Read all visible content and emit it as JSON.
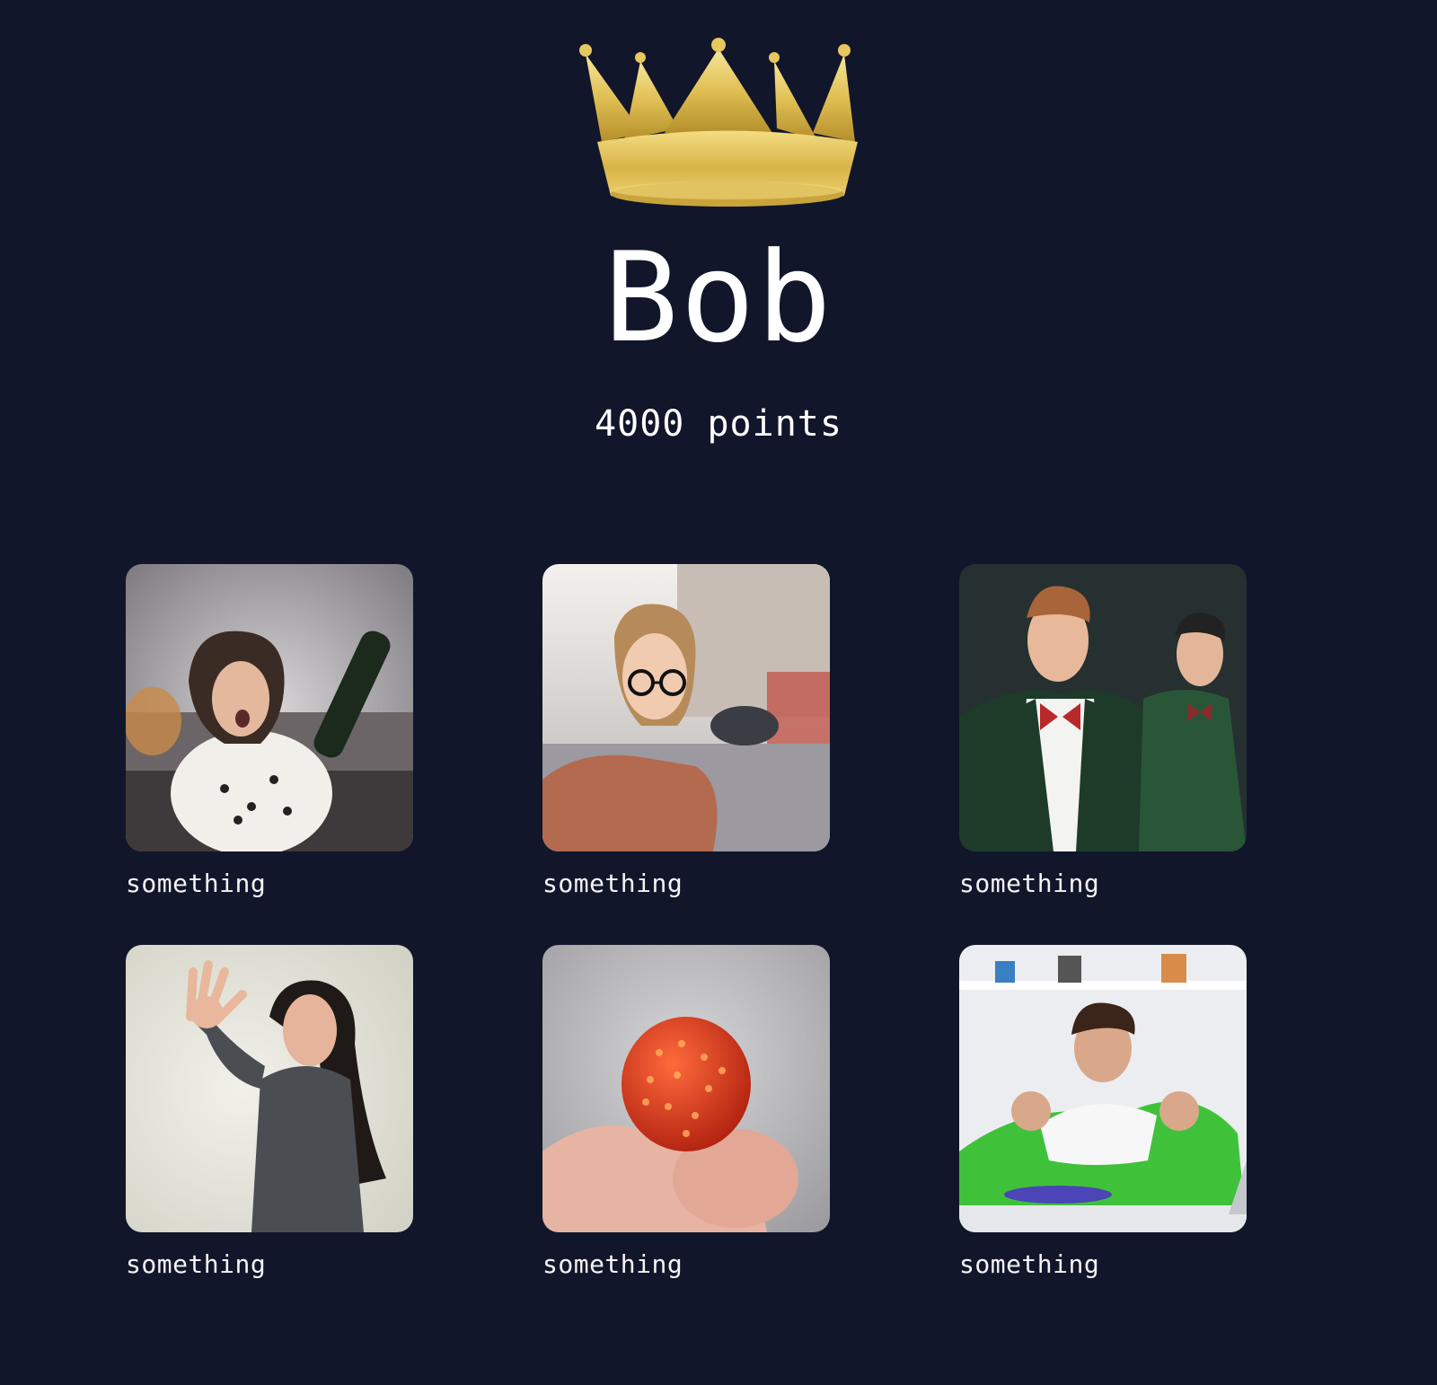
{
  "winner": {
    "name": "Bob",
    "points": "4000 points",
    "crown_icon": "crown-icon"
  },
  "submissions": [
    {
      "caption": "something",
      "image": "woman-with-wine-bottle"
    },
    {
      "caption": "something",
      "image": "girl-with-glasses-street"
    },
    {
      "caption": "something",
      "image": "two-men-in-bow-ties"
    },
    {
      "caption": "something",
      "image": "woman-laughing-waving"
    },
    {
      "caption": "something",
      "image": "red-berry-on-fingertips"
    },
    {
      "caption": "something",
      "image": "boy-on-green-pillow"
    }
  ],
  "colors": {
    "background": "#11162b",
    "text": "#ffffff",
    "crown_gold": "#e2c15a"
  }
}
